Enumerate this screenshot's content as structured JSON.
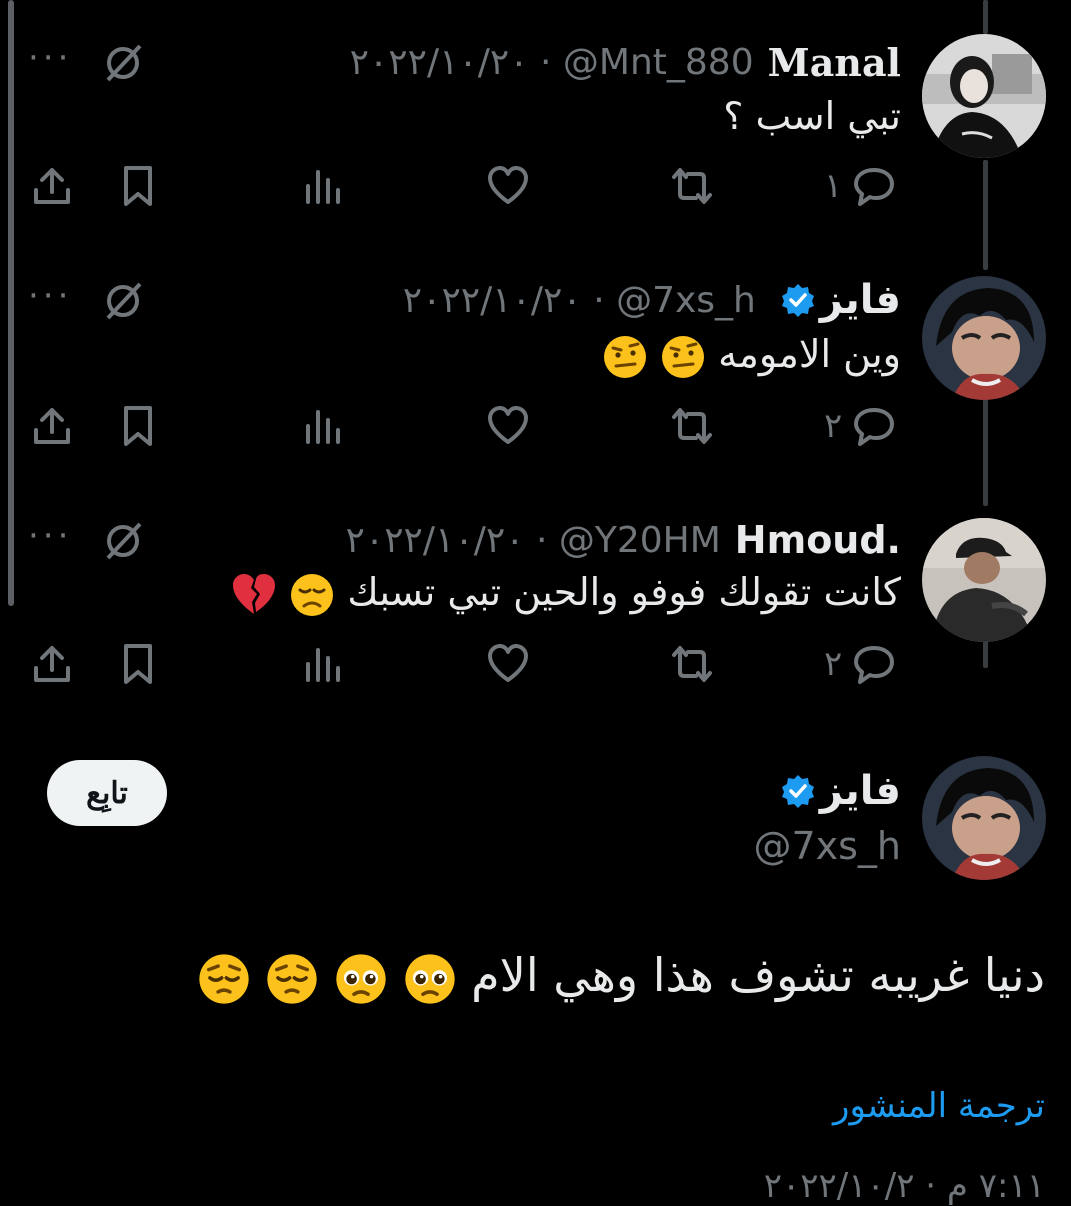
{
  "replies": [
    {
      "name": "Manal",
      "handle": "@Mnt_880",
      "date_sep": "·",
      "date": "٢٠٢٢/١٠/٢٠",
      "text": "تبي اسب ؟",
      "reply_count": "١",
      "verified": false
    },
    {
      "name": "فايز",
      "handle": "@7xs_h",
      "date_sep": "·",
      "date": "٢٠٢٢/١٠/٢٠",
      "text": "وين الامومه",
      "reply_count": "٢",
      "verified": true
    },
    {
      "name": "Hmoud.",
      "handle": "@Y20HM",
      "date_sep": "·",
      "date": "٢٠٢٢/١٠/٢٠",
      "text": "كانت تقولك فوفو والحين تبي تسبك",
      "reply_count": "٢",
      "verified": false
    }
  ],
  "more_label": "···",
  "main_post": {
    "name": "فايز",
    "handle": "@7xs_h",
    "text": "دنيا غريبه تشوف هذا وهي الام",
    "follow_label": "تابِع",
    "translate_label": "ترجمة المنشور",
    "timestamp": "٧:١١ م · ٢٠٢٢/١٠/٢"
  },
  "icons": {
    "reply": "reply-icon",
    "retweet": "retweet-icon",
    "like": "heart-icon",
    "views": "views-icon",
    "bookmark": "bookmark-icon",
    "share": "share-icon",
    "mute": "mute-icon",
    "verified": "verified-badge-icon"
  },
  "colors": {
    "background": "#000000",
    "text": "#e7e9ea",
    "muted": "#71767b",
    "link": "#1d9bf0",
    "verified": "#1d9bf0"
  }
}
